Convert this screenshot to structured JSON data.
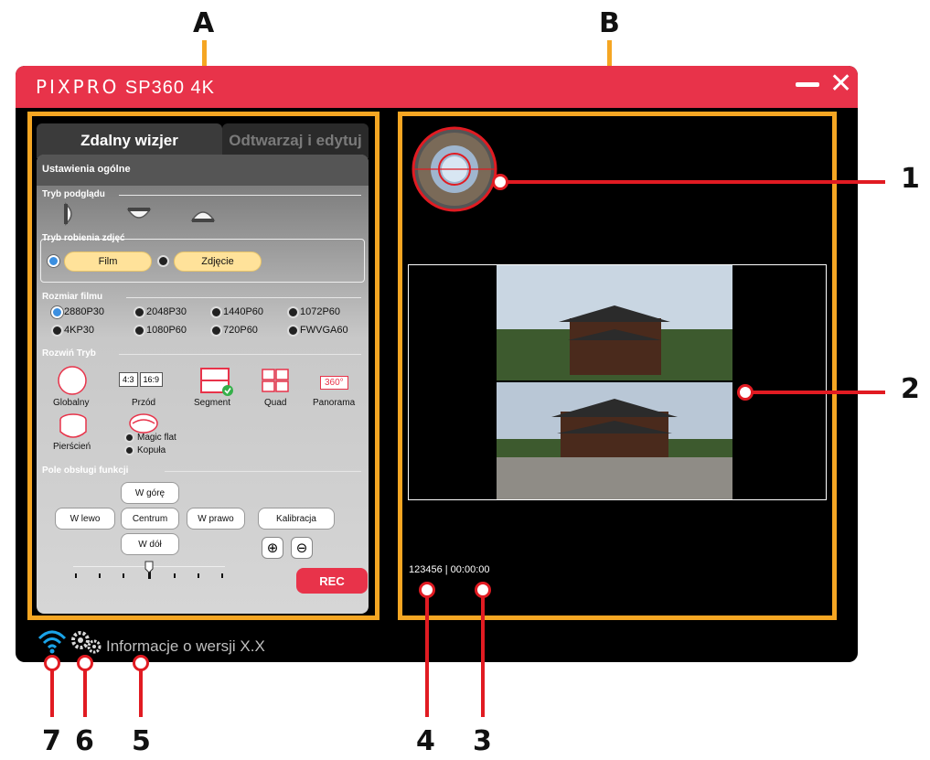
{
  "callouts": {
    "letters": [
      "A",
      "B"
    ],
    "numbers": [
      "1",
      "2",
      "3",
      "4",
      "5",
      "6",
      "7"
    ]
  },
  "app": {
    "brand_logo": "PIXPRO",
    "brand_model": "SP360 4K"
  },
  "tabs": {
    "remote": "Zdalny wizjer",
    "playback": "Odtwarzaj i edytuj"
  },
  "settings": {
    "title": "Ustawienia ogólne",
    "preview_mode": "Tryb podglądu",
    "shoot_mode": "Tryb robienia zdjęć",
    "shoot_options": [
      "Film",
      "Zdjęcie"
    ],
    "film_size": "Rozmiar filmu",
    "film_sizes": [
      "2880P30",
      "2048P30",
      "1440P60",
      "1072P60",
      "4KP30",
      "1080P60",
      "720P60",
      "FWVGA60"
    ],
    "expand_mode": "Rozwiń Tryb",
    "expand_items": [
      "Globalny",
      "Przód",
      "Segment",
      "Quad",
      "Panorama"
    ],
    "front_labels": [
      "4:3",
      "16:9"
    ],
    "panorama_label": "360°",
    "ring": "Pierścień",
    "ring_options": [
      "Magic flat",
      "Kopuła"
    ],
    "control_panel": "Pole obsługi funkcji",
    "buttons": {
      "up": "W górę",
      "left": "W lewo",
      "center": "Centrum",
      "right": "W prawo",
      "calibrate": "Kalibracja",
      "down": "W dół"
    },
    "rec": "REC"
  },
  "viewer": {
    "counter": "123456 | 00:00:00"
  },
  "status": {
    "version": "Informacje o wersji X.X"
  },
  "colors": {
    "brand_red": "#e8334a",
    "highlight_orange": "#f5a623",
    "callout_red": "#e11b22",
    "wifi_blue": "#1aa3e8"
  }
}
